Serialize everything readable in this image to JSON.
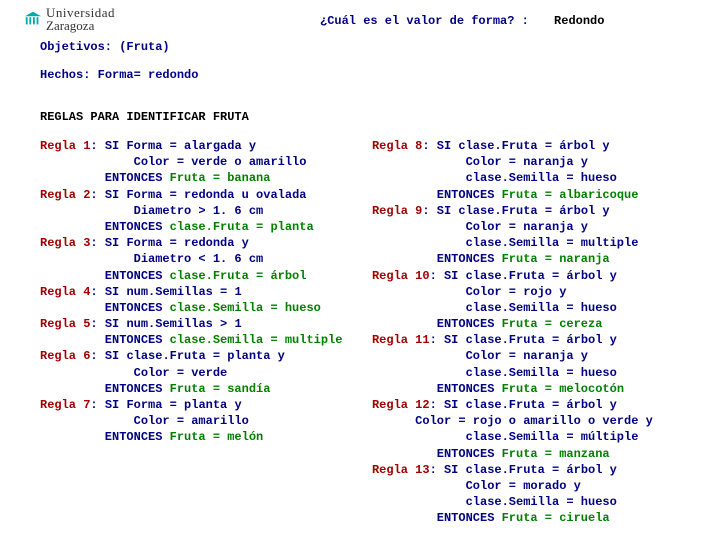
{
  "logo": {
    "line1": "Universidad",
    "line2": "Zaragoza"
  },
  "question": "¿Cuál es el valor de forma? :",
  "answer": "Redondo",
  "objetivos_label": "Objetivos:",
  "objetivos_value": "(Fruta)",
  "hechos_label": "Hechos:",
  "hechos_value": "Forma= redondo",
  "rules_title": "REGLAS PARA IDENTIFICAR FRUTA",
  "kw": {
    "si": "SI",
    "entonces": "ENTONCES"
  },
  "left": [
    {
      "name": "Regla 1",
      "cond": [
        "Forma = alargada y",
        "Color = verde o amarillo"
      ],
      "concl": "Fruta = banana"
    },
    {
      "name": "Regla 2",
      "cond": [
        "Forma = redonda u ovalada",
        "Diametro > 1. 6 cm"
      ],
      "concl": "clase.Fruta = planta"
    },
    {
      "name": "Regla 3",
      "cond": [
        "Forma = redonda y",
        "Diametro < 1. 6 cm"
      ],
      "concl": "clase.Fruta = árbol"
    },
    {
      "name": "Regla 4",
      "cond": [
        "num.Semillas = 1"
      ],
      "concl": "clase.Semilla = hueso"
    },
    {
      "name": "Regla 5",
      "cond": [
        "num.Semillas > 1"
      ],
      "concl": "clase.Semilla = multiple"
    },
    {
      "name": "Regla 6",
      "cond": [
        "clase.Fruta = planta y",
        "Color = verde"
      ],
      "concl": "Fruta = sandía"
    },
    {
      "name": "Regla 7",
      "cond": [
        "Forma = planta y",
        "Color = amarillo"
      ],
      "concl": "Fruta = melón"
    }
  ],
  "right": [
    {
      "name": "Regla 8",
      "cond": [
        "clase.Fruta = árbol y",
        "Color = naranja y",
        "clase.Semilla = hueso"
      ],
      "concl": "Fruta = albaricoque"
    },
    {
      "name": "Regla 9",
      "cond": [
        "clase.Fruta = árbol y",
        "Color = naranja y",
        "clase.Semilla = multiple"
      ],
      "concl": "Fruta = naranja"
    },
    {
      "name": "Regla 10",
      "cond": [
        "clase.Fruta = árbol y",
        "Color = rojo y",
        "clase.Semilla = hueso"
      ],
      "concl": "Fruta = cereza"
    },
    {
      "name": "Regla 11",
      "cond": [
        "clase.Fruta = árbol y",
        "Color = naranja y",
        "clase.Semilla = hueso"
      ],
      "concl": "Fruta = melocotón"
    },
    {
      "name": "Regla 12",
      "cond": [
        "clase.Fruta = árbol y",
        "Color = rojo o amarillo o verde y",
        "clase.Semilla = múltiple"
      ],
      "concl": "Fruta = manzana"
    },
    {
      "name": "Regla 13",
      "cond": [
        "clase.Fruta = árbol y",
        "Color = morado y",
        "clase.Semilla = hueso"
      ],
      "concl": "Fruta = ciruela"
    }
  ]
}
